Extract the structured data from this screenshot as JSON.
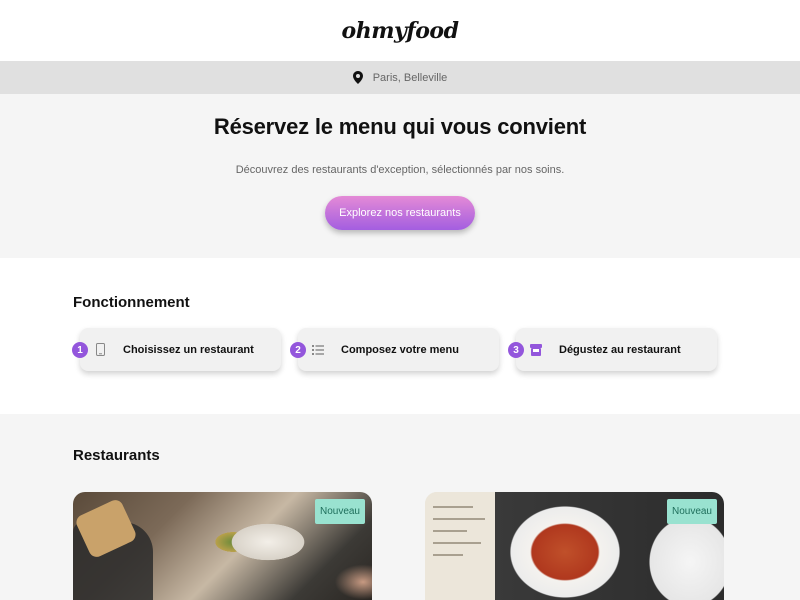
{
  "header": {
    "logo": "ohmyfood"
  },
  "location": {
    "icon": "map-pin-icon",
    "text": "Paris, Belleville"
  },
  "hero": {
    "title": "Réservez le menu qui vous convient",
    "subtitle": "Découvrez des restaurants d'exception, sélectionnés par nos soins.",
    "cta_label": "Explorez nos restaurants"
  },
  "how": {
    "title": "Fonctionnement",
    "steps": [
      {
        "number": "1",
        "icon": "mobile-phone-icon",
        "label": "Choisissez un restaurant"
      },
      {
        "number": "2",
        "icon": "list-icon",
        "label": "Composez votre menu"
      },
      {
        "number": "3",
        "icon": "store-icon",
        "label": "Dégustez au restaurant"
      }
    ]
  },
  "restaurants": {
    "title": "Restaurants",
    "cards": [
      {
        "badge": "Nouveau"
      },
      {
        "badge": "Nouveau"
      }
    ]
  },
  "colors": {
    "accent": "#9356dc",
    "cta_top": "#e48ad6",
    "cta_bottom": "#a35ee0",
    "badge_bg": "#99e2d0"
  }
}
